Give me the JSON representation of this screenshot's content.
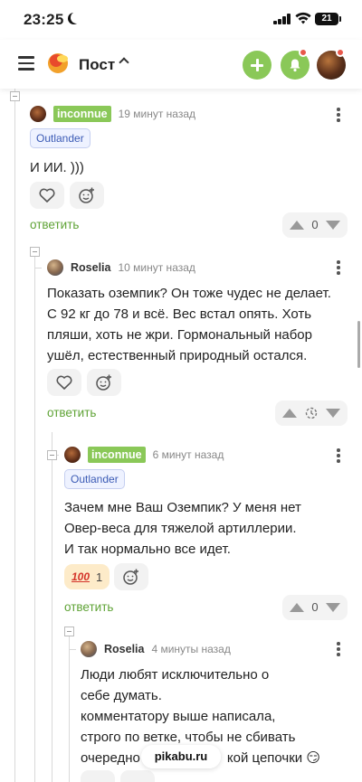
{
  "status": {
    "time": "23:25",
    "battery": "21"
  },
  "header": {
    "title": "Пост"
  },
  "comments": [
    {
      "author": "inconnue",
      "time_ago": "19 минут назад",
      "tag": "Outlander",
      "text": "И ИИ. )))",
      "reply": "ответить",
      "rating": "0"
    },
    {
      "author": "Roselia",
      "time_ago": "10 минут назад",
      "text_lines": [
        "Показать оземпик? Он тоже чудес не делает.",
        "С 92 кг до 78 и всё. Вес встал опять. Хоть",
        "пляши, хоть не жри. Гормональный набор",
        "ушёл, естественный природный остался."
      ],
      "reply": "ответить"
    },
    {
      "author": "inconnue",
      "time_ago": "6 минут назад",
      "tag": "Outlander",
      "text_lines": [
        "Зачем мне Ваш Оземпик? У меня нет",
        "Овер-веса для тяжелой артиллерии.",
        "И так нормально все идет."
      ],
      "reaction_count": "1",
      "reaction_emoji": "100",
      "reply": "ответить",
      "rating": "0"
    },
    {
      "author": "Roselia",
      "time_ago": "4 минуты назад",
      "text_lines": [
        "Люди любят исключительно о",
        "себе думать.",
        "комментатору выше написала,",
        "строго по ветке, чтобы не сбивать",
        "очередно",
        "кой цепочки 😏"
      ]
    }
  ],
  "footer": {
    "site": "pikabu.ru"
  }
}
